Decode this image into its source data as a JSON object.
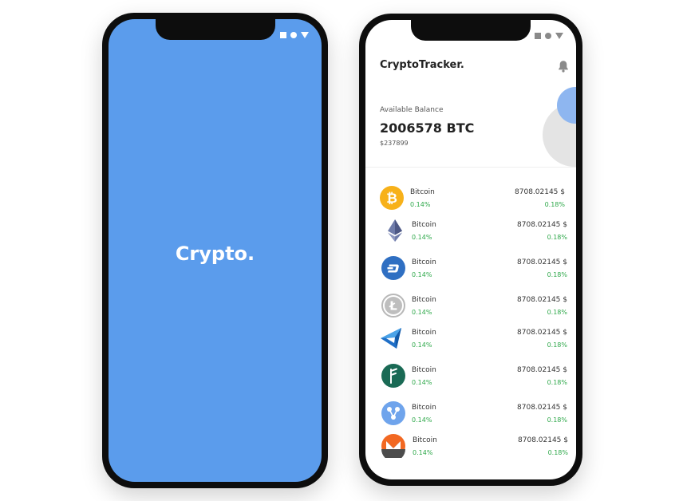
{
  "splash": {
    "title": "Crypto."
  },
  "tracker": {
    "app_title": "CryptoTracker.",
    "balance_label": "Available Balance",
    "balance_value": "2006578 BTC",
    "balance_usd": "$237899",
    "coins": [
      {
        "name": "Bitcoin",
        "change": "0.14%",
        "price": "8708.02145 $",
        "price_change": "0.18%",
        "icon": "bitcoin-icon"
      },
      {
        "name": "Bitcoin",
        "change": "0.14%",
        "price": "8708.02145 $",
        "price_change": "0.18%",
        "icon": "ethereum-icon"
      },
      {
        "name": "Bitcoin",
        "change": "0.14%",
        "price": "8708.02145 $",
        "price_change": "0.18%",
        "icon": "dash-icon"
      },
      {
        "name": "Bitcoin",
        "change": "0.14%",
        "price": "8708.02145 $",
        "price_change": "0.18%",
        "icon": "litecoin-icon"
      },
      {
        "name": "Bitcoin",
        "change": "0.14%",
        "price": "8708.02145 $",
        "price_change": "0.18%",
        "icon": "maidsafe-icon"
      },
      {
        "name": "Bitcoin",
        "change": "0.14%",
        "price": "8708.02145 $",
        "price_change": "0.18%",
        "icon": "factom-icon"
      },
      {
        "name": "Bitcoin",
        "change": "0.14%",
        "price": "8708.02145 $",
        "price_change": "0.18%",
        "icon": "ripple-icon"
      },
      {
        "name": "Bitcoin",
        "change": "0.14%",
        "price": "8708.02145 $",
        "price_change": "0.18%",
        "icon": "monero-icon"
      }
    ]
  },
  "colors": {
    "splash_background": "#5b9cec",
    "positive_change": "#2ea84a",
    "phone_frame": "#0d0d0d"
  }
}
